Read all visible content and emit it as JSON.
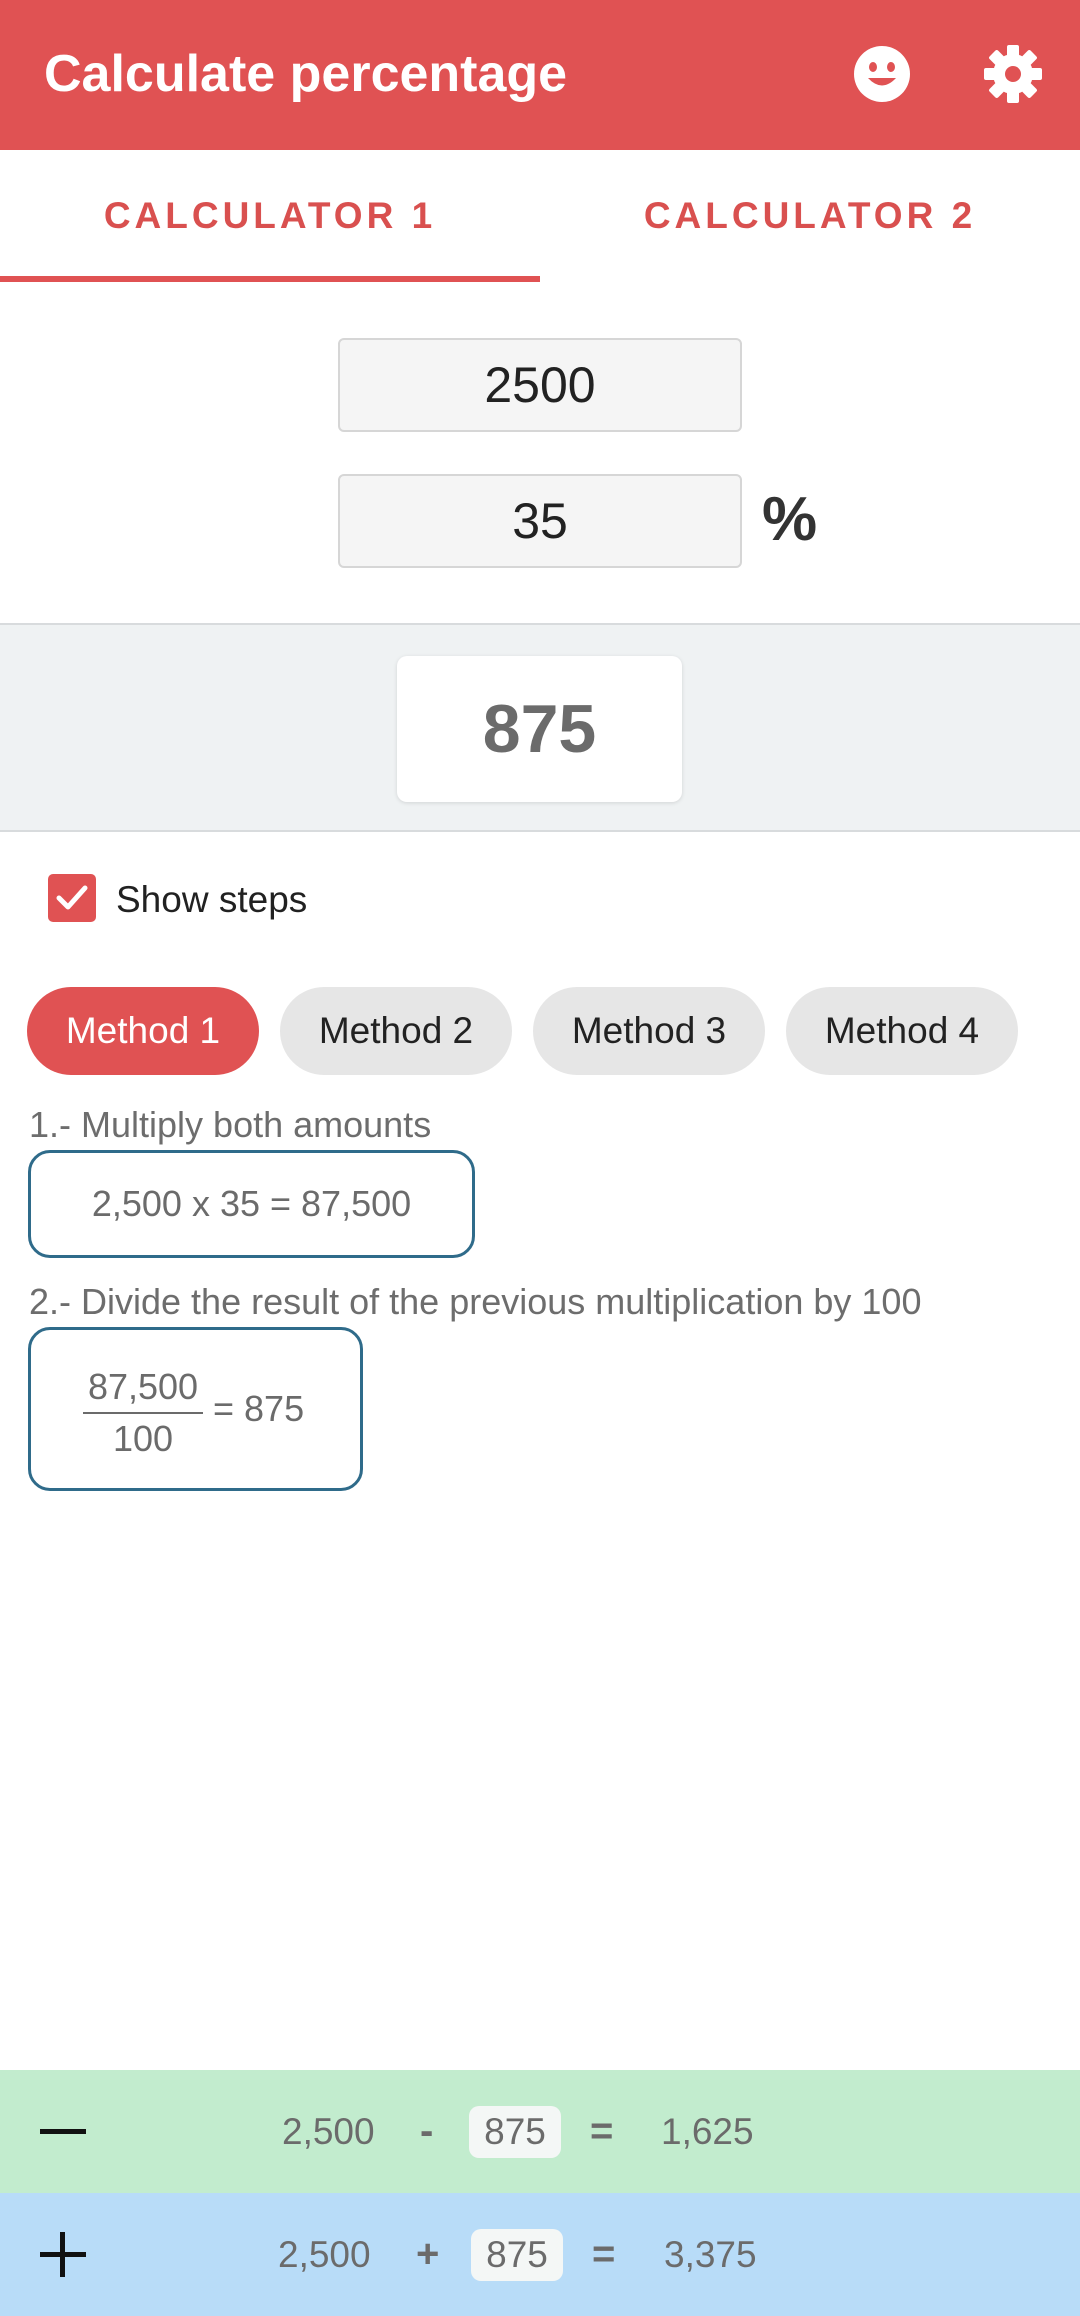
{
  "appbar": {
    "title": "Calculate percentage",
    "icons": [
      "smiley-icon",
      "gear-icon"
    ],
    "color": "#e05253"
  },
  "tabs": [
    {
      "label": "CALCULATOR 1",
      "selected": true
    },
    {
      "label": "CALCULATOR 2",
      "selected": false
    }
  ],
  "inputs": {
    "amount": "2500",
    "percent": "35",
    "percent_symbol": "%"
  },
  "result": "875",
  "show_steps": {
    "label": "Show steps",
    "checked": true
  },
  "methods": [
    {
      "label": "Method 1",
      "active": true
    },
    {
      "label": "Method 2",
      "active": false
    },
    {
      "label": "Method 3",
      "active": false
    },
    {
      "label": "Method 4",
      "active": false
    }
  ],
  "steps": {
    "step1_text": "1.- Multiply both amounts",
    "step1_formula": "2,500 x 35 = 87,500",
    "step2_text": "2.- Divide the result of the previous multiplication by 100",
    "step2_numerator": "87,500",
    "step2_denominator": "100",
    "step2_result": "= 875"
  },
  "bottom_rows": {
    "minus": {
      "sign_icon": "minus-icon",
      "base": "2,500",
      "operator": "-",
      "amount": "875",
      "equals": "=",
      "result": "1,625",
      "color": "#c2ecce"
    },
    "plus": {
      "sign_icon": "plus-icon",
      "base": "2,500",
      "operator": "+",
      "amount": "875",
      "equals": "=",
      "result": "3,375",
      "color": "#b8dcf8"
    }
  }
}
